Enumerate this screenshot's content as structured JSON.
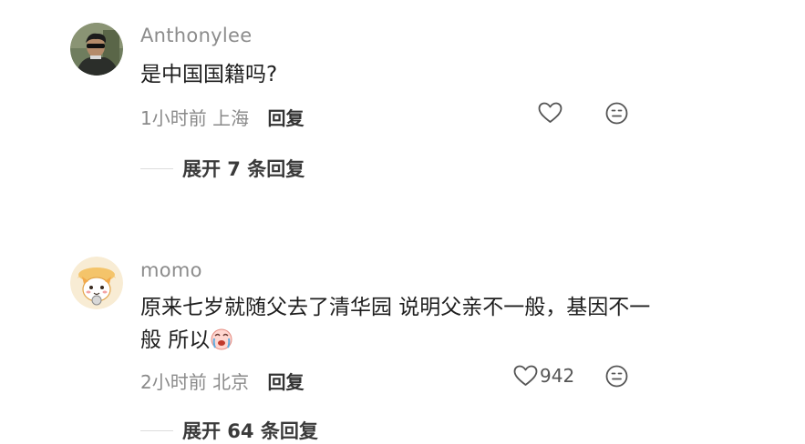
{
  "comments": [
    {
      "username": "Anthonylee",
      "content": "是中国国籍吗?",
      "time": "1小时前",
      "location": "上海",
      "reply_label": "回复",
      "like_count": "",
      "expand_label": "展开 7 条回复",
      "avatar_icon": "man-with-sunglasses-avatar"
    },
    {
      "username": "momo",
      "content": "原来七岁就随父去了清华园 说明父亲不一般，基因不一般 所以",
      "content_emoji": "crying-face-emoji",
      "time": "2小时前",
      "location": "北京",
      "reply_label": "回复",
      "like_count": "942",
      "expand_label": "展开 64 条回复",
      "avatar_icon": "cartoon-cat-avatar"
    }
  ],
  "icons": {
    "like": "heart-outline-icon",
    "emoji": "neutral-face-icon"
  },
  "colors": {
    "username": "#8c8c8c",
    "meta": "#8a8a8a",
    "text": "#1e1e1e",
    "icon": "#555555"
  }
}
